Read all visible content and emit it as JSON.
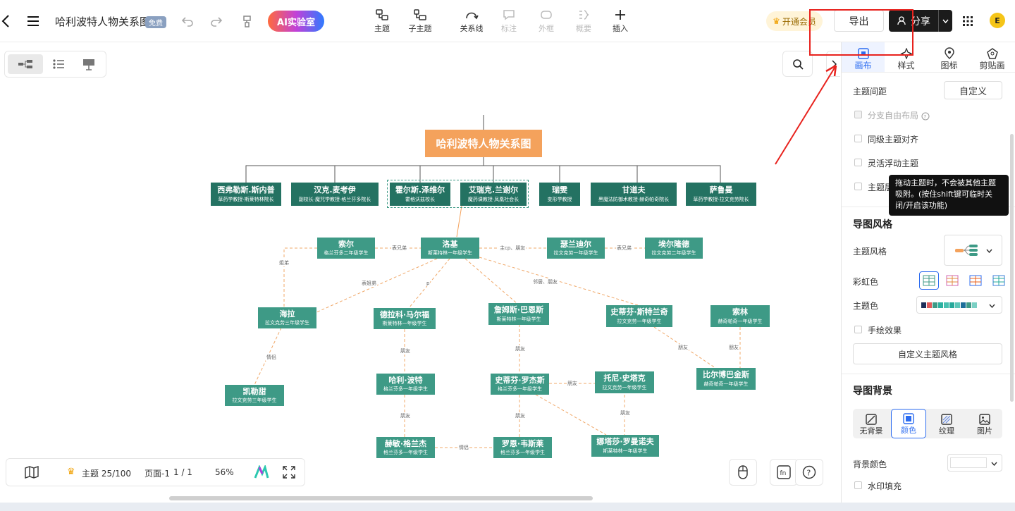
{
  "toolbar": {
    "title": "哈利波特人物关系图",
    "free_badge": "免费",
    "ai_button": "AI实验室",
    "tools": [
      {
        "label": "主题",
        "disabled": false
      },
      {
        "label": "子主题",
        "disabled": false
      },
      {
        "label": "关系线",
        "disabled": false
      },
      {
        "label": "标注",
        "disabled": true
      },
      {
        "label": "外框",
        "disabled": true
      },
      {
        "label": "概要",
        "disabled": true
      },
      {
        "label": "插入",
        "disabled": false
      }
    ],
    "vip_label": "开通会员",
    "export_label": "导出",
    "share_label": "分享",
    "avatar_letter": "E"
  },
  "map": {
    "root": "哈利波特人物关系图",
    "level1": [
      {
        "name": "西弗勒斯.斯内普",
        "desc": "草药学教授·斯莱特林院长"
      },
      {
        "name": "汉克.麦考伊",
        "desc": "副校长·魔咒学教授·格兰芬多院长"
      },
      {
        "name": "霍尔斯.泽维尔",
        "desc": "霍格沃兹校长"
      },
      {
        "name": "艾瑞克.兰谢尔",
        "desc": "魔药课教授·凤凰社会长"
      },
      {
        "name": "瑞雯",
        "desc": "变形学教授"
      },
      {
        "name": "甘道夫",
        "desc": "黑魔法防御术教授·赫奇帕奇院长"
      },
      {
        "name": "萨鲁曼",
        "desc": "草药学教授·拉文克劳院长"
      }
    ],
    "students": [
      {
        "name": "索尔",
        "desc": "格兰芬多二年级学生"
      },
      {
        "name": "洛基",
        "desc": "斯莱特林一年级学生"
      },
      {
        "name": "瑟兰迪尔",
        "desc": "拉文克劳一年级学生"
      },
      {
        "name": "埃尔隆德",
        "desc": "拉文克劳二年级学生"
      },
      {
        "name": "海拉",
        "desc": "拉文克劳三年级学生"
      },
      {
        "name": "德拉科·马尔福",
        "desc": "斯莱特林一年级学生"
      },
      {
        "name": "詹姆斯·巴恩斯",
        "desc": "斯莱特林一年级学生"
      },
      {
        "name": "史蒂芬·斯特兰奇",
        "desc": "拉文克劳一年级学生"
      },
      {
        "name": "索林",
        "desc": "赫奇帕奇一年级学生"
      },
      {
        "name": "凯勒甜",
        "desc": "拉文克劳三年级学生"
      },
      {
        "name": "哈利·波特",
        "desc": "格兰芬多一年级学生"
      },
      {
        "name": "史蒂芬·罗杰斯",
        "desc": "格兰芬多一年级学生"
      },
      {
        "name": "托尼·史塔克",
        "desc": "拉文克劳一年级学生"
      },
      {
        "name": "比尔博巴金斯",
        "desc": "赫奇帕奇一年级学生"
      },
      {
        "name": "赫敏·格兰杰",
        "desc": "格兰芬多一年级学生"
      },
      {
        "name": "罗恩·韦斯莱",
        "desc": "格兰芬多一年级学生"
      },
      {
        "name": "娜塔莎·罗曼诺夫",
        "desc": "斯莱特林一年级学生"
      }
    ],
    "relations": {
      "r1": "表兄弟",
      "r2": "主cp、朋友",
      "r3": "表兄弟",
      "r4": "姐弟",
      "r5": "表姐弟",
      "r6": "p",
      "r7": "邻居、朋友",
      "r8": "情侣",
      "r9": "朋友",
      "r10": "朋友",
      "r11": "朋友",
      "r12": "朋友",
      "r13": "朋友",
      "r14": "朋友",
      "r15": "朋友",
      "r16": "朋友",
      "r17": "情侣"
    }
  },
  "bottom": {
    "topic_count": "主题 25/100",
    "page_label": "页面-1",
    "page_index": "1 / 1",
    "zoom": "56%"
  },
  "panel": {
    "tabs": [
      {
        "label": "画布",
        "active": true
      },
      {
        "label": "样式",
        "active": false
      },
      {
        "label": "图标",
        "active": false
      },
      {
        "label": "剪贴画",
        "active": false
      }
    ],
    "spacing_label": "主题间距",
    "spacing_value": "自定义",
    "options": [
      {
        "label": "分支自由布局",
        "disabled": true
      },
      {
        "label": "同级主题对齐",
        "disabled": false
      },
      {
        "label": "灵活浮动主题",
        "disabled": false
      },
      {
        "label": "主题层",
        "disabled": false
      }
    ],
    "tooltip": "拖动主题时，不会被其他主题吸附。(按住shift键可临时关闭/开启该功能)",
    "style_heading": "导图风格",
    "style_label": "主题风格",
    "rainbow_label": "彩虹色",
    "theme_color_label": "主题色",
    "handdrawn_label": "手绘效果",
    "custom_style_button": "自定义主题风格",
    "bg_heading": "导图背景",
    "bg_tabs": [
      {
        "label": "无背景",
        "active": false
      },
      {
        "label": "颜色",
        "active": true
      },
      {
        "label": "纹理",
        "active": false
      },
      {
        "label": "图片",
        "active": false
      }
    ],
    "bg_color_label": "背景颜色",
    "watermark_label": "水印填充"
  },
  "colors": {
    "accent": "#2c6cf0",
    "node_dark": "#247262",
    "node_mid": "#3e9a86",
    "root": "#f4a25c",
    "highlight": "#e8221d"
  }
}
